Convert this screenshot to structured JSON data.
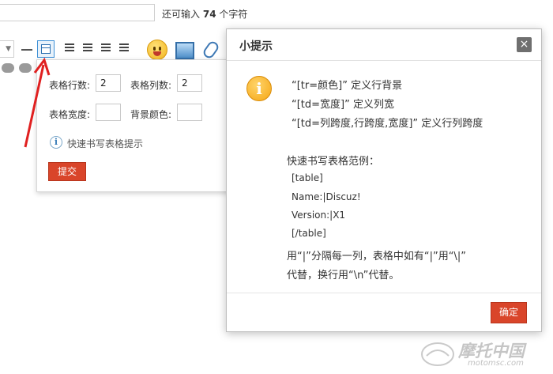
{
  "editor": {
    "remaining_prefix": "还可输入",
    "remaining_count": "74",
    "remaining_suffix": "个字符"
  },
  "table_popup": {
    "rows_label": "表格行数:",
    "rows_value": "2",
    "cols_label": "表格列数:",
    "cols_value": "2",
    "width_label": "表格宽度:",
    "width_value": "",
    "bgcolor_label": "背景颜色:",
    "bgcolor_value": "",
    "hint_link": "快速书写表格提示",
    "submit_label": "提交"
  },
  "tip_dialog": {
    "title": "小提示",
    "close_glyph": "×",
    "lines": [
      "“[tr=颜色]” 定义行背景",
      "“[td=宽度]” 定义列宽",
      "“[td=列跨度,行跨度,宽度]” 定义行列跨度"
    ],
    "example_heading": "快速书写表格范例：",
    "example_lines": [
      "[table]",
      "Name:|Discuz!",
      "Version:|X1",
      "[/table]"
    ],
    "note_line1": "用“|”分隔每一列，表格中如有“|”用“\\|”",
    "note_line2": "代替，换行用“\\n”代替。",
    "ok_label": "确定"
  },
  "watermark": {
    "text": "摩托中国",
    "sub": "motomsc.com"
  },
  "colors": {
    "accent_red": "#d9452a",
    "arrow_red": "#e02020",
    "info_orange": "#f5a614"
  }
}
